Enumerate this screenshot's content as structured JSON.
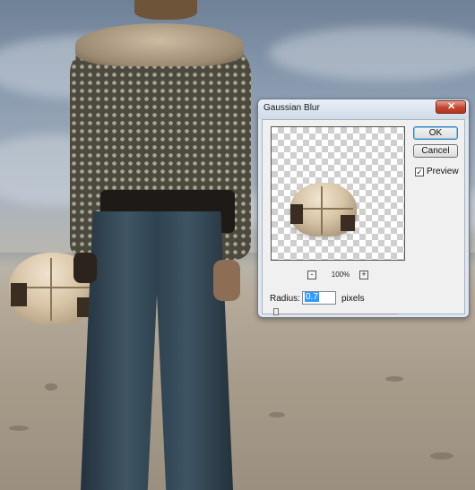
{
  "dialog": {
    "title": "Gaussian Blur",
    "close_glyph": "✕",
    "ok_label": "OK",
    "cancel_label": "Cancel",
    "preview_label": "Preview",
    "preview_checked": true,
    "check_glyph": "✓",
    "zoom_out_glyph": "-",
    "zoom_in_glyph": "+",
    "zoom_level": "100%",
    "radius_label": "Radius:",
    "radius_value": "0.7",
    "radius_units": "pixels",
    "radius_slider_level": 0.02
  },
  "colors": {
    "close_button": "#c3452d",
    "selection": "#3399ff",
    "dialog_frame": "#dfe6ee"
  },
  "icons": [
    "close-icon",
    "zoom-out-icon",
    "zoom-in-icon",
    "checkmark-icon"
  ]
}
